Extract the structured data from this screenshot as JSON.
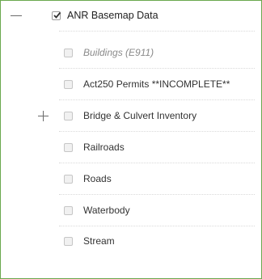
{
  "tree": {
    "root": {
      "label": "ANR Basemap Data",
      "checked": true,
      "expanded": true
    },
    "children": [
      {
        "label": "Buildings (E911)",
        "checked": false,
        "disabled": true
      },
      {
        "label": "Act250 Permits **INCOMPLETE**",
        "checked": false
      },
      {
        "label": "Bridge & Culvert Inventory",
        "checked": false,
        "expandable": true
      },
      {
        "label": "Railroads",
        "checked": false
      },
      {
        "label": "Roads",
        "checked": false
      },
      {
        "label": "Waterbody",
        "checked": false
      },
      {
        "label": "Stream",
        "checked": false
      }
    ]
  },
  "icons": {
    "collapse": "minus-icon",
    "expand": "plus-icon",
    "check": "check-icon"
  },
  "colors": {
    "panel_border": "#6aa84f",
    "disabled_text": "#8a8a8a"
  }
}
